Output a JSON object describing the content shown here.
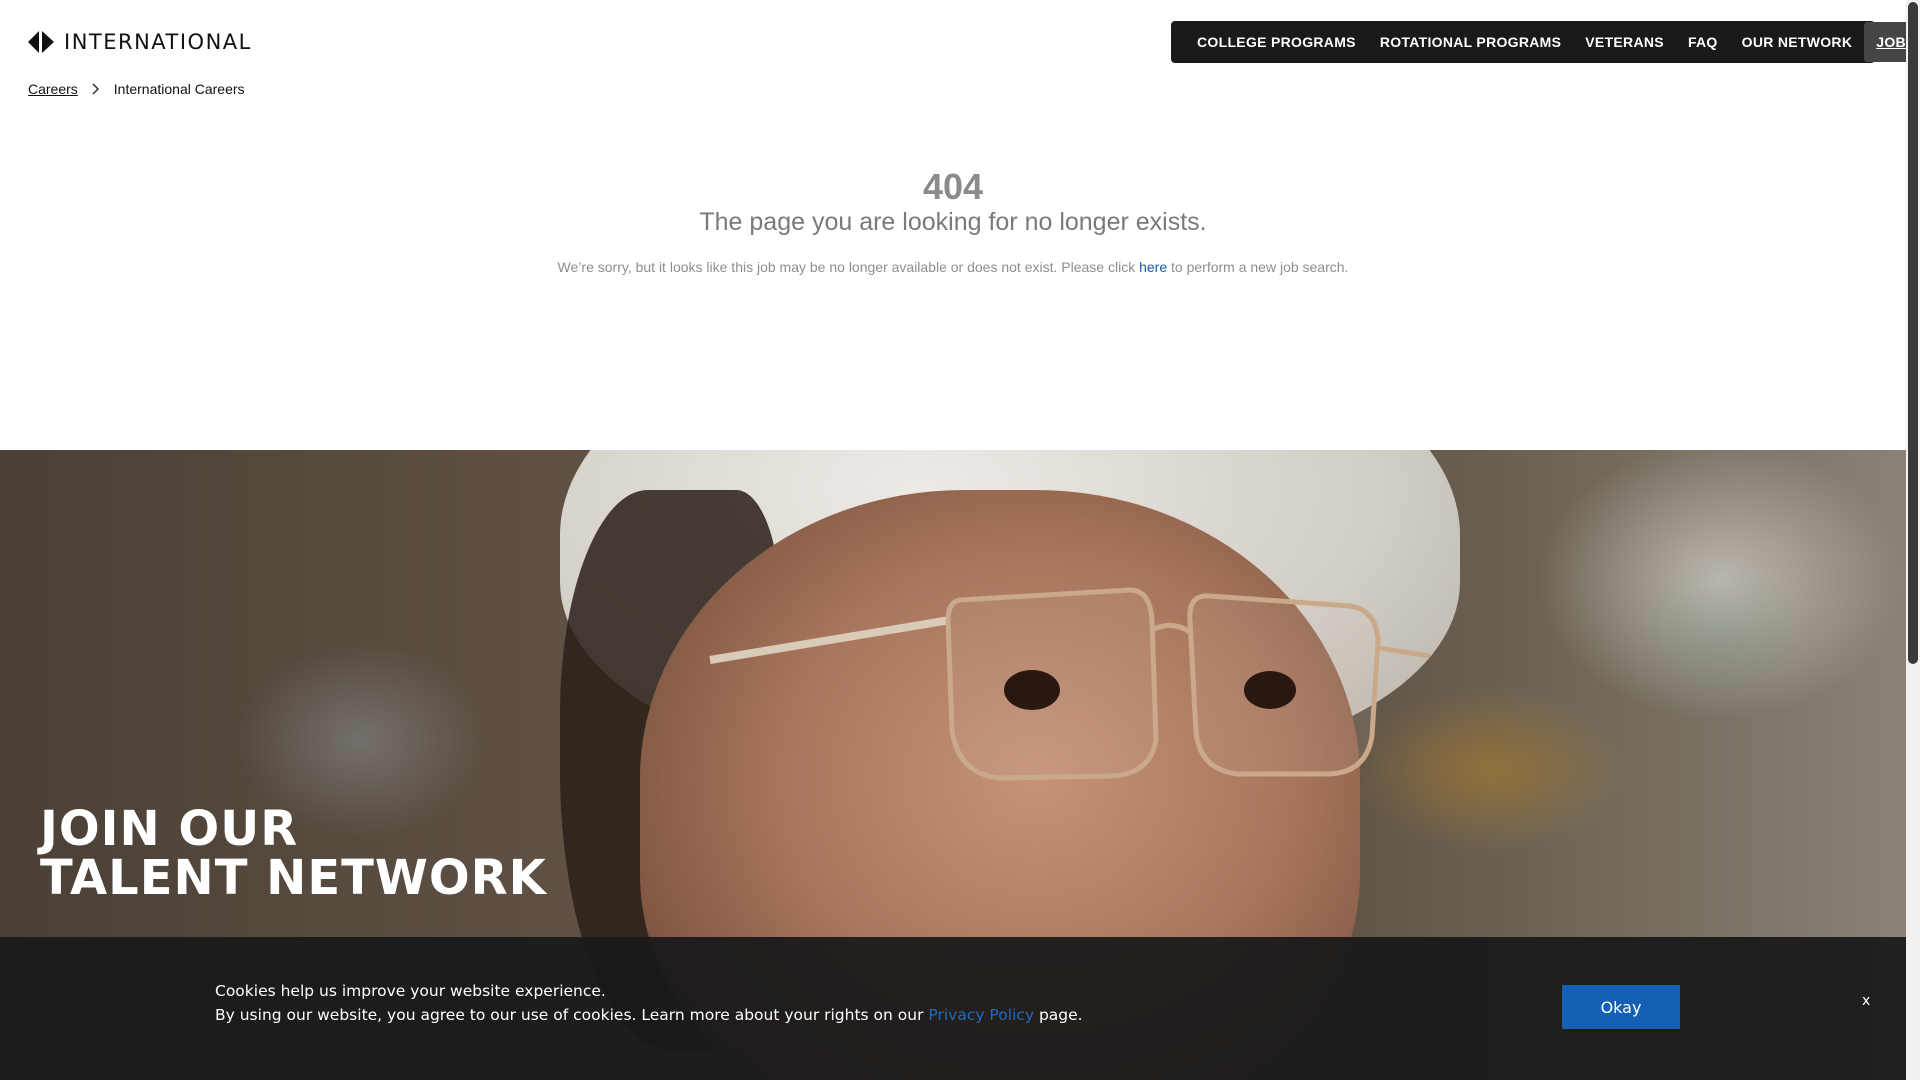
{
  "header": {
    "logo_text": "INTERNATIONAL",
    "nav": [
      {
        "label": "COLLEGE PROGRAMS"
      },
      {
        "label": "ROTATIONAL PROGRAMS"
      },
      {
        "label": "VETERANS"
      },
      {
        "label": "FAQ"
      },
      {
        "label": "OUR NETWORK"
      },
      {
        "label": "JOBS"
      }
    ]
  },
  "breadcrumb": {
    "items": [
      {
        "label": "Careers"
      },
      {
        "label": "International Careers"
      }
    ]
  },
  "error": {
    "code": "404",
    "title": "The page you are looking for no longer exists.",
    "message_before": "We’re sorry, but it looks like this job may be no longer available or does not exist. Please click ",
    "link": "here",
    "message_after": " to perform a new job search."
  },
  "hero": {
    "title_line1": "JOIN OUR",
    "title_line2": "TALENT NETWORK"
  },
  "cookie": {
    "line1": "Cookies help us improve your website experience.",
    "line2_before": "By using our website, you agree to our use of cookies. Learn more about your rights on our ",
    "link": "Privacy Policy",
    "line2_after": " page.",
    "ok_label": "Okay",
    "close_label": "x"
  },
  "colors": {
    "nav_background": "#1a1a1a",
    "link_blue": "#1a5aa6",
    "button_blue": "#1560b5",
    "cookie_background": "#1a1a1a"
  }
}
